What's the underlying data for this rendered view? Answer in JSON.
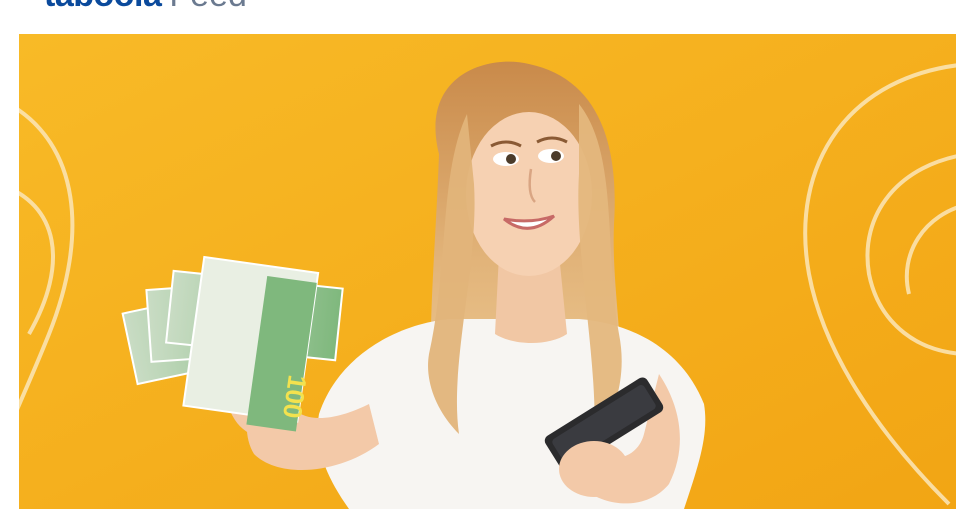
{
  "header": {
    "logo_name": "taboola",
    "logo_feed_text": "Feed"
  },
  "ad": {
    "image_icon": "woman-holding-money-and-phone-icon",
    "background_color": "#f6b21e",
    "note_value": "100"
  }
}
